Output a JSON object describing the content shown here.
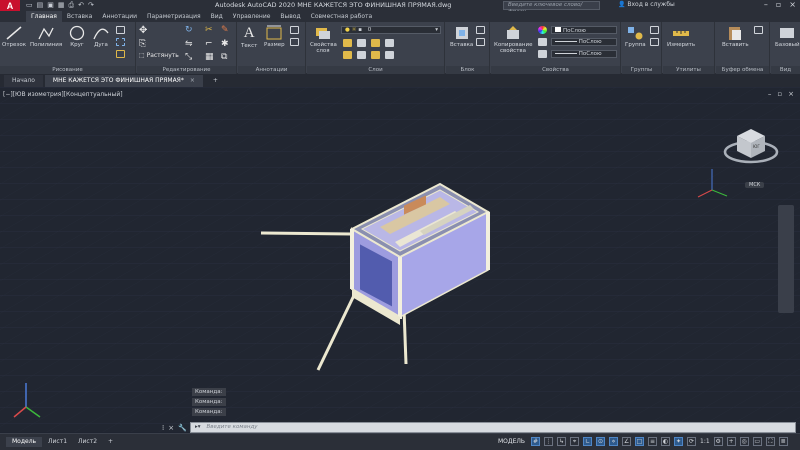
{
  "app": {
    "logo": "A",
    "title": "Autodesk AutoCAD 2020   МНЕ КАЖЕТСЯ ЭТО ФИНИШНАЯ ПРЯМАЯ.dwg",
    "search_placeholder": "Введите ключевое слово/фразу",
    "login": "Вход в службы"
  },
  "ribbon_tabs": [
    "Главная",
    "Вставка",
    "Аннотации",
    "Параметризация",
    "Вид",
    "Управление",
    "Вывод",
    "Совместная работа"
  ],
  "ribbon": {
    "draw": {
      "label": "Рисование",
      "tools": [
        "Отрезок",
        "Полилиния",
        "Круг",
        "Дуга"
      ]
    },
    "modify": {
      "label": "Редактирование",
      "stretch": "Растянуть"
    },
    "annotation": {
      "label": "Аннотации",
      "text": "Текст",
      "dimension": "Размер"
    },
    "layers": {
      "label": "Слои",
      "layer_props": "Свойства слоя",
      "current_layer": "0"
    },
    "block": {
      "label": "Блок",
      "insert": "Вставка"
    },
    "properties": {
      "label": "Свойства",
      "match": "Копирование свойства",
      "color": "ПоСлою",
      "linetype": "ПоСлою",
      "lineweight": "ПоСлою"
    },
    "groups": {
      "label": "Группы",
      "group": "Группа"
    },
    "utilities": {
      "label": "Утилиты",
      "measure": "Измерить"
    },
    "clipboard": {
      "label": "Буфер обмена",
      "paste": "Вставить"
    },
    "view": {
      "label": "Вид",
      "base": "Базовый"
    }
  },
  "file_tabs": [
    {
      "label": "Начало"
    },
    {
      "label": "МНЕ КАЖЕТСЯ ЭТО ФИНИШНАЯ ПРЯМАЯ*"
    }
  ],
  "viewport": {
    "label": "[−][ЮВ изометрия][Концептуальный]",
    "viewcube_face": "ЮГ",
    "wcs": "МСК"
  },
  "command": {
    "history": [
      "Команда:",
      "Команда:",
      "Команда:"
    ],
    "placeholder": "Введите команду"
  },
  "layouts": [
    "Модель",
    "Лист1",
    "Лист2"
  ],
  "status": {
    "mode": "МОДЕЛЬ",
    "scale": "1:1"
  },
  "colors": {
    "accent": "#c8102e",
    "ribbon_bg": "#3c414c",
    "viewport_bg": "#212631",
    "model_body": "#a7a6e8",
    "model_frame": "#ece8d0"
  }
}
